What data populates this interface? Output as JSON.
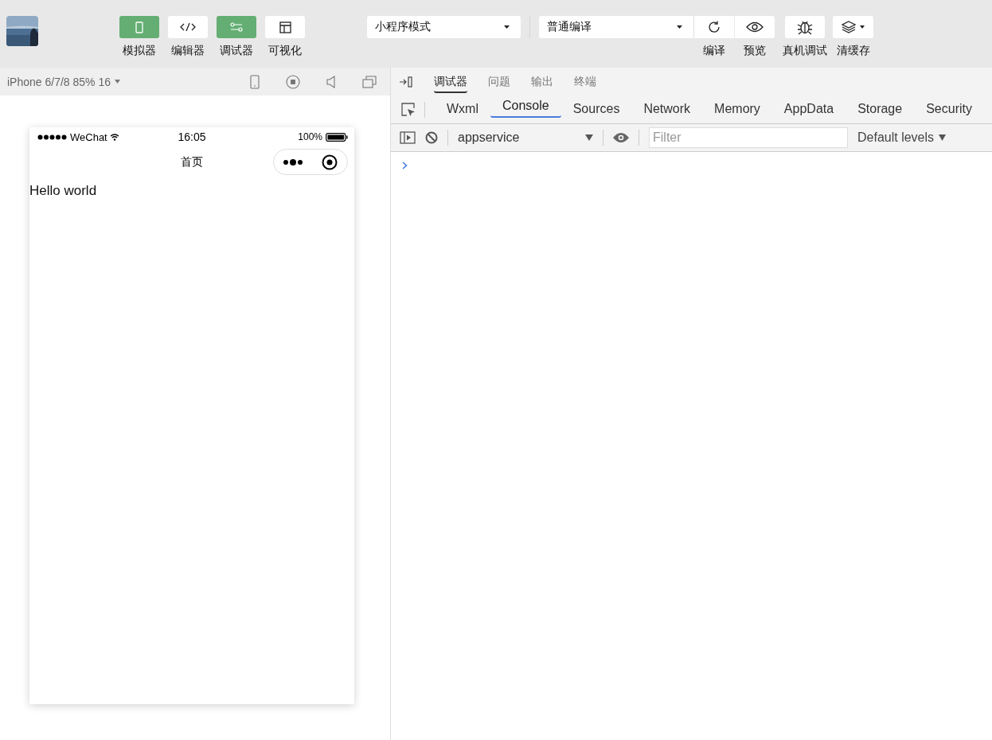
{
  "view_toggles": [
    {
      "label": "模拟器",
      "kind": "phone",
      "on": true
    },
    {
      "label": "编辑器",
      "kind": "code",
      "on": false
    },
    {
      "label": "调试器",
      "kind": "sliders",
      "on": true
    },
    {
      "label": "可视化",
      "kind": "layout",
      "on": false
    }
  ],
  "mode_select": {
    "value": "小程序模式"
  },
  "compile_select": {
    "value": "普通编译"
  },
  "actions": [
    {
      "label": "编译",
      "kind": "refresh"
    },
    {
      "label": "预览",
      "kind": "eye"
    },
    {
      "label": "真机调试",
      "kind": "bug"
    },
    {
      "label": "清缓存",
      "kind": "layers"
    }
  ],
  "simulator": {
    "device": "iPhone 6/7/8 85% 16",
    "carrier": "WeChat",
    "time": "16:05",
    "battery": "100%",
    "page_title": "首页",
    "content": "Hello world"
  },
  "devtools": {
    "top_tabs": [
      {
        "label": "调试器",
        "selected": true
      },
      {
        "label": "问题",
        "selected": false
      },
      {
        "label": "输出",
        "selected": false
      },
      {
        "label": "终端",
        "selected": false
      }
    ],
    "panel_tabs": [
      {
        "label": "Wxml",
        "selected": false
      },
      {
        "label": "Console",
        "selected": true
      },
      {
        "label": "Sources",
        "selected": false
      },
      {
        "label": "Network",
        "selected": false
      },
      {
        "label": "Memory",
        "selected": false
      },
      {
        "label": "AppData",
        "selected": false
      },
      {
        "label": "Storage",
        "selected": false
      },
      {
        "label": "Security",
        "selected": false
      }
    ],
    "console": {
      "context": "appservice",
      "filter_placeholder": "Filter",
      "levels": "Default levels"
    }
  }
}
